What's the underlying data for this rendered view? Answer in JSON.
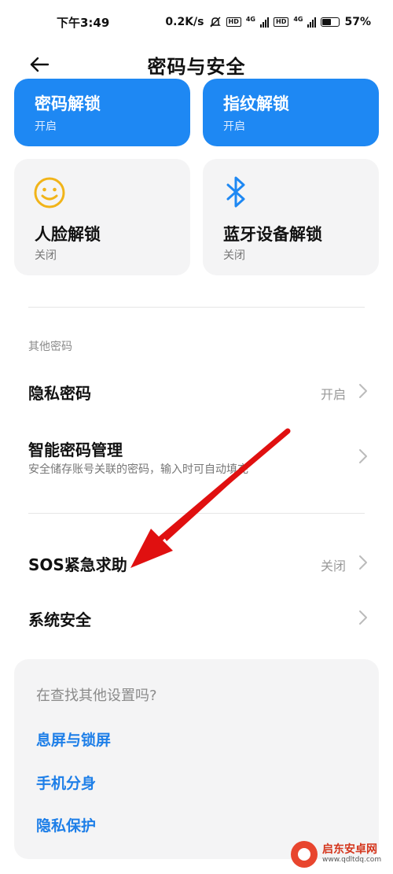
{
  "status_bar": {
    "time": "下午3:49",
    "speed": "0.2K/s",
    "hd1": "HD",
    "net1": "4G",
    "hd2": "HD",
    "net2": "4G",
    "battery": "57%",
    "battery_level": 0.57
  },
  "header": {
    "title": "密码与安全",
    "back_icon": "arrow-left-icon"
  },
  "unlock_cards": [
    {
      "title": "密码解锁",
      "status": "开启"
    },
    {
      "title": "指纹解锁",
      "status": "开启"
    },
    {
      "title": "人脸解锁",
      "status": "关闭",
      "icon": "smile-face-icon"
    },
    {
      "title": "蓝牙设备解锁",
      "status": "关闭",
      "icon": "bluetooth-icon"
    }
  ],
  "other_section": {
    "label": "其他密码",
    "items": [
      {
        "title": "隐私密码",
        "value": "开启"
      },
      {
        "title": "智能密码管理",
        "subtitle": "安全储存账号关联的密码，输入时可自动填充"
      }
    ]
  },
  "more_items": [
    {
      "title": "SOS紧急求助",
      "value": "关闭"
    },
    {
      "title": "系统安全"
    }
  ],
  "suggest": {
    "title": "在查找其他设置吗?",
    "links": [
      "息屏与锁屏",
      "手机分身",
      "隐私保护"
    ]
  },
  "watermark": {
    "name": "启东安卓网",
    "url": "www.qdltdq.com"
  },
  "colors": {
    "accent": "#1e88f3",
    "link": "#1e7fe8",
    "annotation_arrow": "#e01010"
  }
}
